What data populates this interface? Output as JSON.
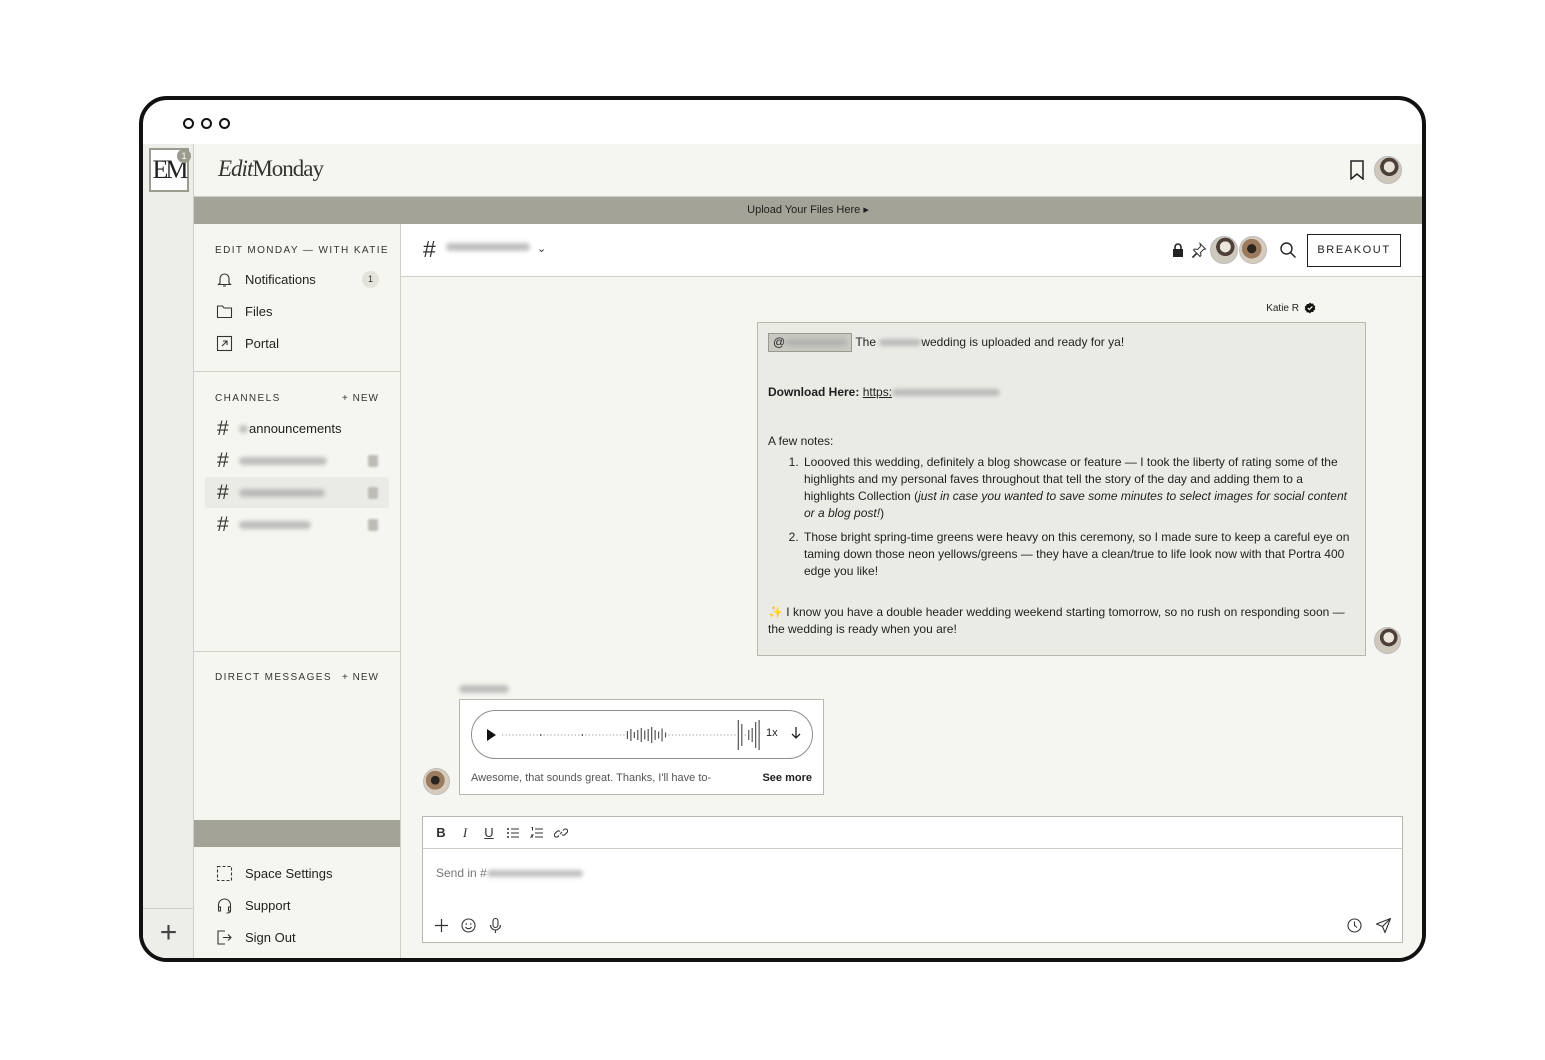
{
  "app": {
    "brand_script": "Edit",
    "brand_serif": "Monday",
    "rail_logo": "EM",
    "rail_badge": "1"
  },
  "banner": {
    "label": "Upload Your Files Here ▸"
  },
  "sidebar": {
    "workspace_title": "EDIT MONDAY — WITH KATIE",
    "nav": [
      {
        "label": "Notifications",
        "icon": "bell-icon",
        "count": "1"
      },
      {
        "label": "Files",
        "icon": "folder-icon"
      },
      {
        "label": "Portal",
        "icon": "external-link-icon"
      }
    ],
    "channels_title": "CHANNELS",
    "new_label": "+ NEW",
    "channels": [
      {
        "name": "announcements",
        "active": false
      },
      {
        "name": "",
        "active": false
      },
      {
        "name": "",
        "active": true
      },
      {
        "name": "",
        "active": false
      }
    ],
    "dm_title": "DIRECT MESSAGES",
    "footer": [
      {
        "label": "Space Settings",
        "icon": "settings-frame-icon"
      },
      {
        "label": "Support",
        "icon": "headset-icon"
      },
      {
        "label": "Sign Out",
        "icon": "sign-out-icon"
      }
    ]
  },
  "channel_header": {
    "hash": "#",
    "breakout_label": "BREAKOUT"
  },
  "messages": {
    "katie": {
      "sender": "Katie R",
      "line1_pre": "The",
      "line1_post": "wedding is uploaded and ready for ya!",
      "download_label": "Download Here:",
      "download_link": "https:",
      "notes_title": "A few notes:",
      "note1_a": "Loooved this wedding, definitely a blog showcase or feature — I took the liberty of rating some of the highlights and my personal faves throughout that tell the story of the day and adding them to a highlights Collection (",
      "note1_italic": "just in case you wanted to save some minutes to select images for social content or a blog post!",
      "note1_b": ")",
      "note2": "Those bright spring-time greens were heavy on this ceremony, so I made sure to keep a careful eye on taming down those neon yellows/greens — they have a clean/true to life look now with that Portra 400 edge you like!",
      "closing_sparkle": "✨",
      "closing": " I know you have a double header wedding weekend starting tomorrow, so no rush on responding soon — the wedding is ready when you are!"
    },
    "voice": {
      "speed": "1x",
      "transcript": "Awesome, that sounds great. Thanks, I'll have to-",
      "see_more": "See more"
    }
  },
  "composer": {
    "placeholder": "Send in #"
  }
}
